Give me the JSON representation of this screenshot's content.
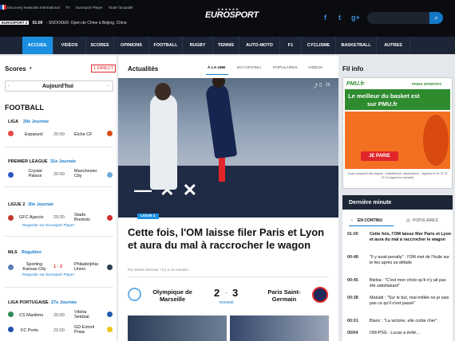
{
  "colors": {
    "accent": "#1a8fe0",
    "nav_bg": "#1c2636",
    "top_bg": "#0a0c10",
    "pmu_green": "#2e8b2e",
    "pmu_orange": "#f36f21",
    "red": "#e0262b"
  },
  "header": {
    "links": [
      "Discovery Networks International",
      "TV",
      "Eurosport Player",
      "Toute l'actualité"
    ],
    "ticker_logo": "EUROSPORT 2",
    "ticker_time": "01:00",
    "ticker_text": "- SNOOKER: Open de Chine à Beijing, Chine",
    "brand": "EUROSPORT",
    "stars": "★★★★★★"
  },
  "nav": [
    "ACCUEIL",
    "VIDÉOS",
    "SCORES",
    "OPINIONS",
    "FOOTBALL",
    "RUGBY",
    "TENNIS",
    "AUTO-MOTO",
    "F1",
    "CYCLISME",
    "BASKETBALL",
    "AUTRES"
  ],
  "scores": {
    "title": "Scores",
    "badge": "1 DIRECT",
    "date": "Aujourd'hui",
    "sport": "FOOTBALL",
    "leagues": [
      {
        "name": "LIGA",
        "round": "29e Journée",
        "home": "Espanyol",
        "score": "20:00",
        "away": "Elche CF"
      },
      {
        "name": "PREMIER LEAGUE",
        "round": "31e Journée",
        "home": "Crystal Palace",
        "score": "20:00",
        "away": "Manchester City"
      },
      {
        "name": "LIGUE 2",
        "round": "30e Journée",
        "home": "GFC Ajaccio",
        "score": "20:30",
        "away": "Stade Brestois",
        "link": "Regarder sur Eurosport Player"
      },
      {
        "name": "MLS",
        "round": "Régulière",
        "home": "Sporting Kansas City",
        "score": "1 - 2",
        "away": "Philadelphia Union",
        "link": "Regarder sur Eurosport Player"
      },
      {
        "name": "LIGA PORTUGAISE",
        "round": "27e Journée",
        "home": "CS Maritimo",
        "score": "20:00",
        "away": "Vitória Setúbal",
        "home2": "FC Porto",
        "score2": "22:00",
        "away2": "GD Estoril Praia"
      }
    ]
  },
  "actualites": {
    "title": "Actualités",
    "tabs": [
      "À LA UNE",
      "EN CONTINU",
      "POPULAIRES",
      "VIDÉOS"
    ],
    "share_icon": "share-icon",
    "comments": "25",
    "tag": "LIGUE 1",
    "headline": "Cette fois, l'OM laisse filer Paris et Lyon et aura du mal à raccrocher le wagon",
    "byline": "Par Martin Mosnier • il y a 25 minutes",
    "team_home": "Olympique de Marseille",
    "score_home": "2",
    "score_dash": "-",
    "score_away": "3",
    "team_away": "Paris Saint-Germain",
    "status": "TERMINÉ"
  },
  "filinfo": {
    "title": "Fil info",
    "pmu_logo": "PMU.fr",
    "pmu_tag": "PARIS SPORTIFS",
    "pmu_line1": "Le meilleur du basket est",
    "pmu_line2": "sur PMU.fr",
    "pmu_btn": "JE PARIE",
    "pmu_legal": "Jouer comporte des risques : endettement, dépendance... Appelez le 09 74 75 13 13 (appel non surtaxé)",
    "dm_title": "Dernière minute",
    "dm_tabs": [
      "EN CONTINU",
      "POPULAIRES"
    ],
    "news": [
      {
        "time": "01:00",
        "text": "Cette fois, l'OM laisse filer Paris et Lyon et aura du mal à raccrocher le wagon"
      },
      {
        "time": "00:48",
        "text": "\"Il y avait penalty\" : l'OM met de l'huile sur le feu après sa défaite"
      },
      {
        "time": "00:45",
        "text": "Bielsa : \"C'est mon choix qu'il n'y ait pas été satisfaisant\""
      },
      {
        "time": "00:38",
        "text": "Matuidi : \"Sur le but, mal-mêlée ne je sais pas ce qu'il s'est passé\""
      },
      {
        "time": "00:01",
        "text": "Blanc : \"La victoire, elle coûte cher\""
      },
      {
        "time": "05/04",
        "text": "OM-PSG : Lucas a évité..."
      }
    ]
  }
}
